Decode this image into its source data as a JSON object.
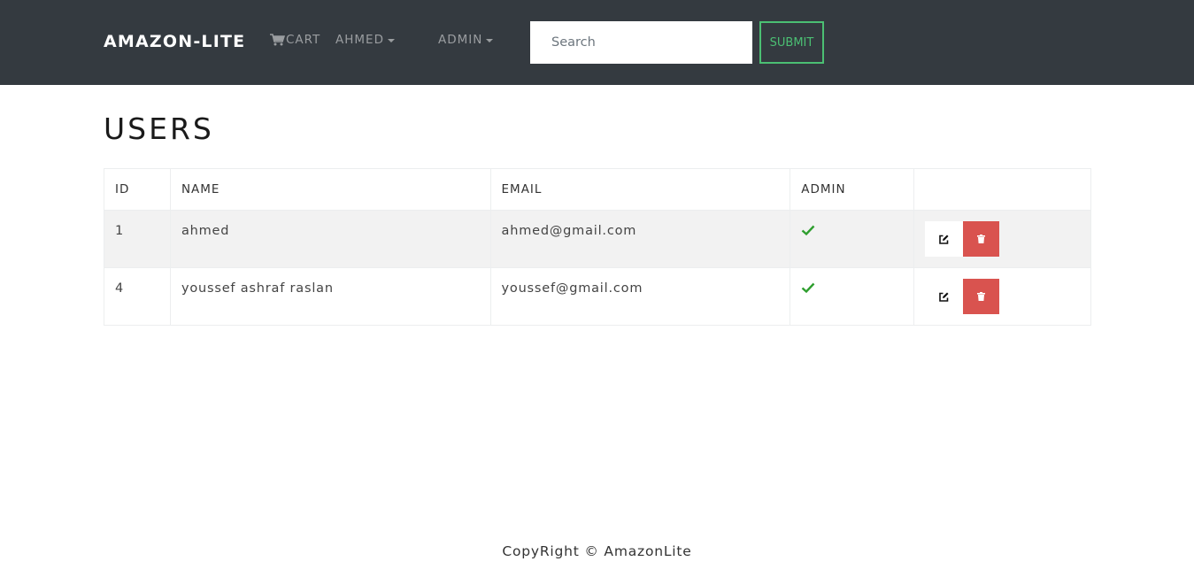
{
  "navbar": {
    "brand": "AMAZON-LITE",
    "cart_label": "CART",
    "user_menu_label": "AHMED",
    "admin_menu_label": "ADMIN",
    "search_placeholder": "Search",
    "submit_label": "SUBMIT",
    "cart_icon": "shopping-cart-icon"
  },
  "page": {
    "title": "USERS"
  },
  "users_table": {
    "columns": [
      "ID",
      "NAME",
      "EMAIL",
      "ADMIN",
      ""
    ],
    "rows": [
      {
        "id": "1",
        "name": "ahmed",
        "email": "ahmed@gmail.com",
        "admin": true
      },
      {
        "id": "4",
        "name": "youssef ashraf raslan",
        "email": "youssef@gmail.com",
        "admin": true
      }
    ],
    "admin_icon": "check-icon",
    "edit_icon": "edit-icon",
    "delete_icon": "trash-icon"
  },
  "footer": {
    "text": "CopyRight © AmazonLite"
  },
  "colors": {
    "navbar_bg": "#343a40",
    "success": "#4bbf73",
    "danger": "#d9534f",
    "check": "#2e9e2e"
  }
}
